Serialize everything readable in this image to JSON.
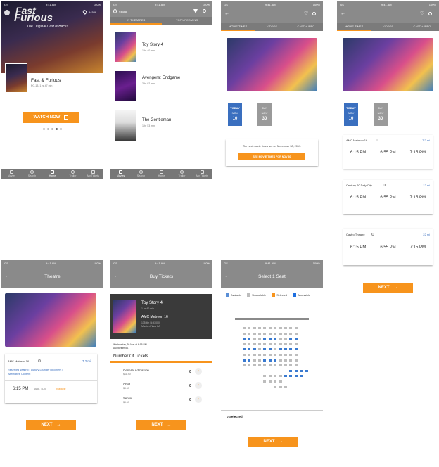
{
  "status": {
    "carrier": "GS",
    "time": "9:41 AM",
    "battery": "100%"
  },
  "s1": {
    "location": "94588",
    "poster_line1": "Fast",
    "poster_line2": "Furious",
    "poster_sub": "The Original Cast is Back!",
    "movie_title": "Fast & Furious",
    "movie_meta": "PG-13, 1 hr 47 min",
    "watch_label": "WATCH NOW",
    "nav": [
      "Movies",
      "Search",
      "Home",
      "Trailer",
      "My Tickets"
    ]
  },
  "s2": {
    "location": "94588",
    "tabs": [
      "IN THEATRES",
      "TOP UPCOMING"
    ],
    "movies": [
      {
        "title": "Toy Story 4",
        "meta": "1 hr 40 min"
      },
      {
        "title": "Avengers: Endgame",
        "meta": "3 hr 02 min"
      },
      {
        "title": "The Gentleman",
        "meta": "1 hr 53 min"
      }
    ],
    "nav": [
      "Movies",
      "Search",
      "Home",
      "Trailer",
      "My Tickets"
    ]
  },
  "s3": {
    "tabs": [
      "MOVIE TIMES",
      "VIDEOS",
      "CAST + INFO"
    ],
    "today": {
      "label": "TODAY",
      "month": "NOV",
      "day": "10"
    },
    "sun": {
      "label": "SUN",
      "month": "NOV",
      "day": "30"
    },
    "notice": "The next movie times are on November 30, 2019.",
    "see_button": "SEE MOVIE TIMES FOR NOV 30"
  },
  "s4": {
    "tabs": [
      "MOVIE TIMES",
      "VIDEOS",
      "CAST + INFO"
    ],
    "today": {
      "label": "TODAY",
      "month": "NOV",
      "day": "10"
    },
    "sun": {
      "label": "SUN",
      "month": "NOV",
      "day": "30"
    },
    "theatres": [
      {
        "name": "AMC Metreon 16",
        "distance": "7.2 mi",
        "times": [
          "6:15 PM",
          "6:55 PM",
          "7:15 PM"
        ]
      },
      {
        "name": "Century 20 Daly City",
        "distance": "12 mi",
        "times": [
          "6:15 PM",
          "6:55 PM",
          "7:15 PM"
        ]
      },
      {
        "name": "Castro Theatre",
        "distance": "22 mi",
        "times": [
          "6:15 PM",
          "6:55 PM",
          "7:15 PM"
        ]
      }
    ],
    "next_label": "NEXT"
  },
  "s5": {
    "title": "Theatre",
    "theatre": "AMC Metreon 16",
    "distance": "7.2 mi",
    "amenities": "Reserved seating  •  Luxury Lounger Recliners  •  Alternative Content",
    "time": "6:15 PM",
    "format": "Audi, 4DX",
    "availability": "Available",
    "next_label": "NEXT"
  },
  "s6": {
    "title": "Buy Tickets",
    "movie": "Toy Story 4",
    "meta": "1 hr 40 min",
    "theatre": "AMC Metreon 16",
    "addr1": "135 4th St #3000",
    "addr2": "Mission Plaza CA",
    "showtime_line1": "Wednesday, 30 Nov at 6:15 PM",
    "showtime_line2": "Auditorium 5A",
    "section_title": "Number Of Tickets",
    "tickets": [
      {
        "type": "General Admission",
        "price": "$11.90",
        "qty": "0"
      },
      {
        "type": "Child",
        "price": "$9.15",
        "qty": "0"
      },
      {
        "type": "Senior",
        "price": "$9.15",
        "qty": "0"
      }
    ],
    "next_label": "NEXT"
  },
  "s7": {
    "title": "Select 1 Seat",
    "legend": [
      "Available",
      "Unavailable",
      "Selected",
      "Accessible"
    ],
    "selected_text": "0 Selected:",
    "next_label": "NEXT"
  },
  "colors": {
    "orange": "#f7941d",
    "gray": "#8a8a8a",
    "blue": "#3a6fbf"
  }
}
